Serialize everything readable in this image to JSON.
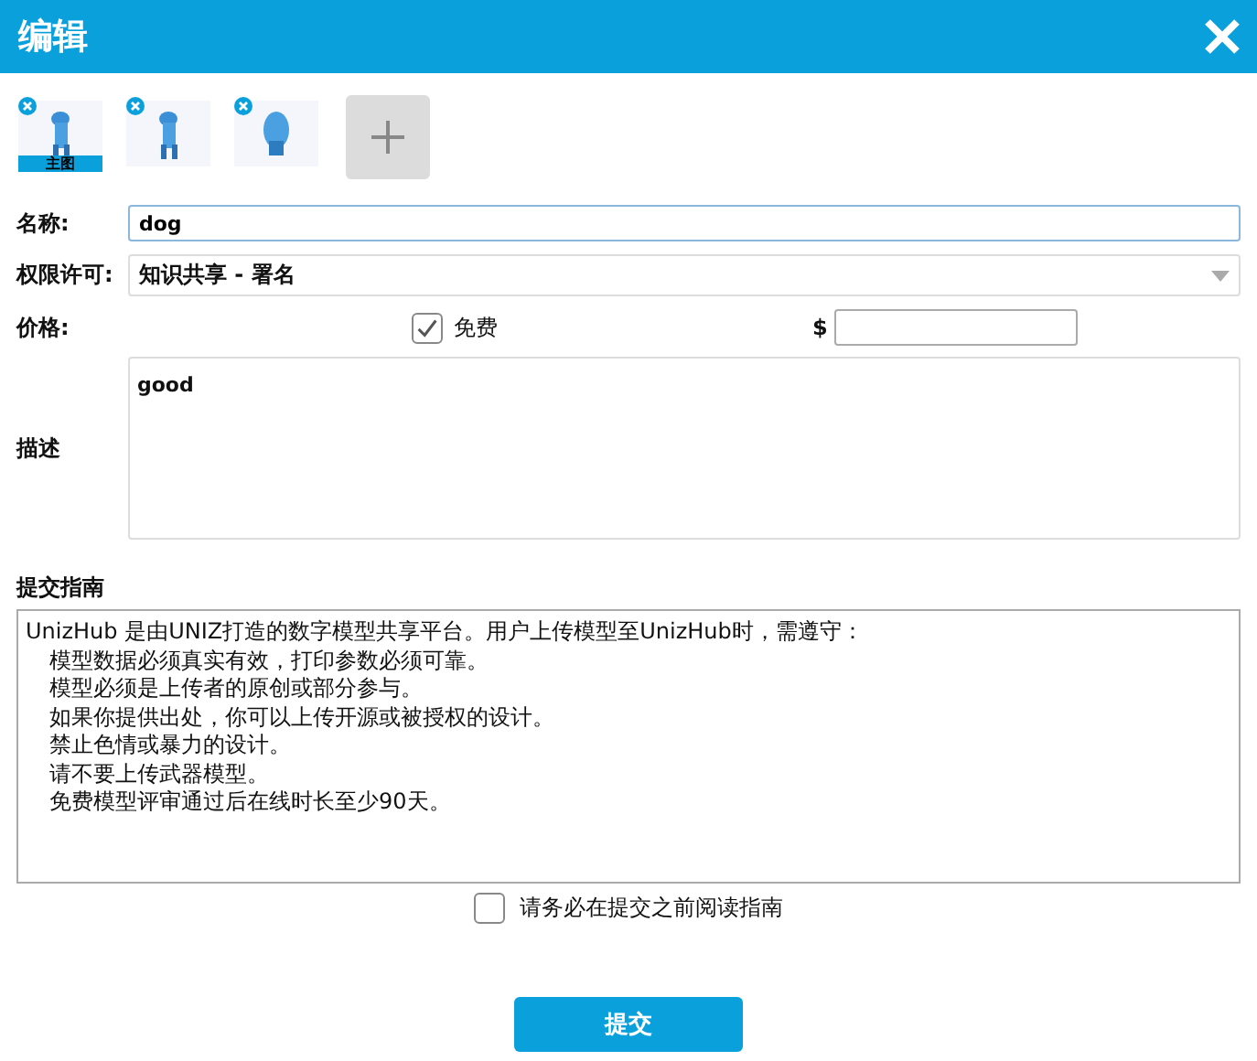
{
  "window": {
    "title": "编辑"
  },
  "thumbnails": [
    {
      "kind": "picture",
      "main_label": "主图"
    },
    {
      "kind": "picture"
    },
    {
      "kind": "picture"
    }
  ],
  "name": {
    "label": "名称:",
    "value": "dog"
  },
  "license": {
    "label": "权限许可:",
    "value": "知识共享 - 署名"
  },
  "price": {
    "label": "价格:",
    "free_label": "免费",
    "free_checked": true,
    "currency": "$"
  },
  "description": {
    "label": "描述",
    "value": "good"
  },
  "guide": {
    "title": "提交指南",
    "lines": [
      "UnizHub 是由UNIZ打造的数字模型共享平台。用户上传模型至UnizHub时，需遵守：",
      "模型数据必须真实有效，打印参数必须可靠。",
      "模型必须是上传者的原创或部分参与。",
      "如果你提供出处，你可以上传开源或被授权的设计。",
      "禁止色情或暴力的设计。",
      "请不要上传武器模型。",
      "免费模型评审通过后在线时长至少90天。"
    ]
  },
  "agree": {
    "label": "请务必在提交之前阅读指南",
    "checked": false
  },
  "submit": "提交"
}
